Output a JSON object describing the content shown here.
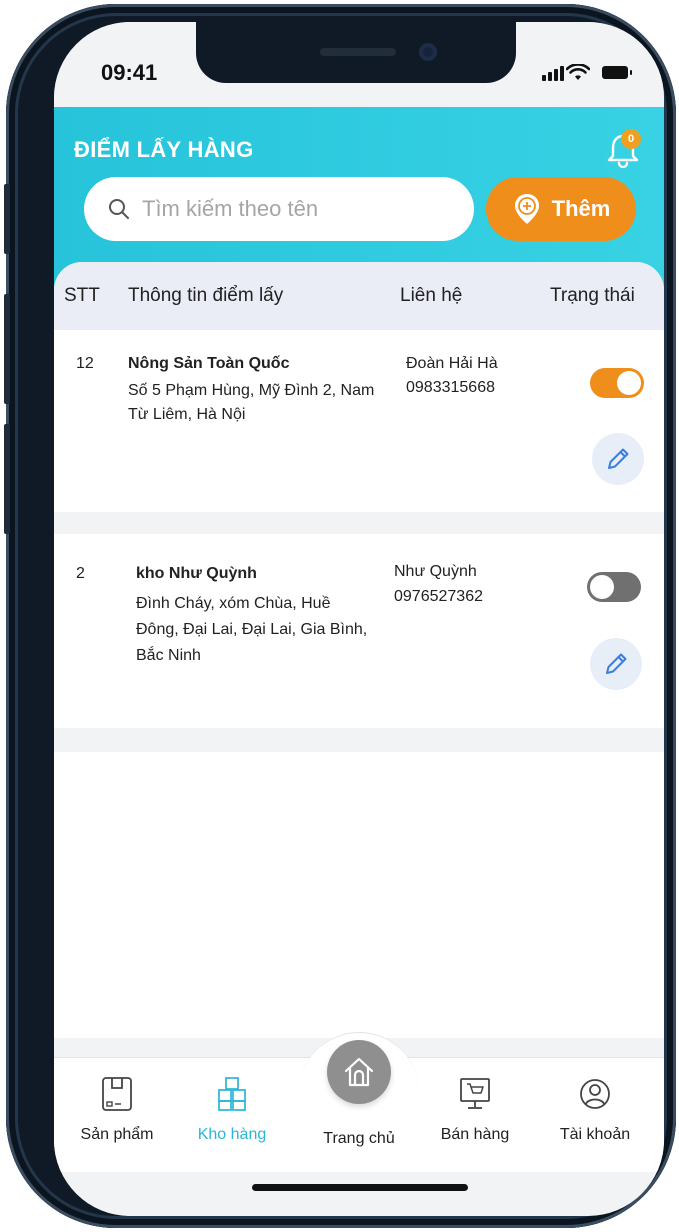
{
  "status_bar": {
    "time": "09:41"
  },
  "header": {
    "title": "ĐIỂM LẤY HÀNG",
    "notification_count": "0",
    "search": {
      "placeholder": "Tìm kiếm theo tên",
      "value": ""
    },
    "add_label": "Thêm"
  },
  "table": {
    "columns": [
      "STT",
      "Thông tin điểm lấy",
      "Liên hệ",
      "Trạng thái"
    ],
    "rows": [
      {
        "stt": "12",
        "name": "Nông Sản Toàn Quốc",
        "address_line1": "Số 5 Phạm Hùng, Mỹ Đình 2, Nam",
        "address_line2": "Từ Liêm, Hà Nội",
        "contact_name": "Đoàn Hải Hà",
        "contact_phone": "0983315668",
        "active": true
      },
      {
        "stt": "2",
        "name": "kho Như Quỳnh",
        "address_line1": "Đình Cháy, xóm Chùa, Huề",
        "address_line2": "Đông, Đại Lai, Đại Lai, Gia Bình,",
        "address_line3": "Bắc Ninh",
        "contact_name": "Như Quỳnh",
        "contact_phone": "0976527362",
        "active": false
      }
    ]
  },
  "bottom_nav": {
    "items": [
      {
        "label": "Sản phẩm",
        "icon": "product-icon",
        "active": false
      },
      {
        "label": "Kho hàng",
        "icon": "warehouse-icon",
        "active": true
      },
      {
        "label": "Trang chủ",
        "icon": "home-icon",
        "active": false
      },
      {
        "label": "Bán hàng",
        "icon": "sales-icon",
        "active": false
      },
      {
        "label": "Tài khoản",
        "icon": "account-icon",
        "active": false
      }
    ]
  },
  "colors": {
    "header": "#26c3da",
    "accent_orange": "#f08e1b",
    "active_nav": "#2cb6d4",
    "toggle_off": "#707070"
  }
}
